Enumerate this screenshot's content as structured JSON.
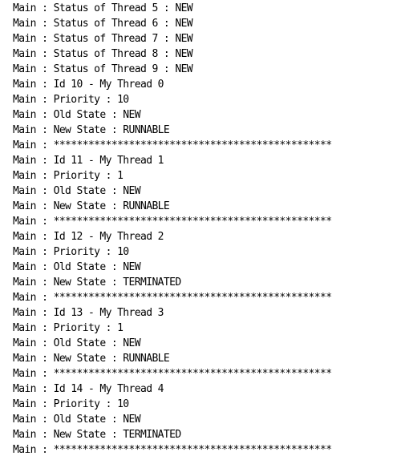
{
  "console": {
    "lines": [
      "Main : Status of Thread 5 : NEW",
      "Main : Status of Thread 6 : NEW",
      "Main : Status of Thread 7 : NEW",
      "Main : Status of Thread 8 : NEW",
      "Main : Status of Thread 9 : NEW",
      "Main : Id 10 - My Thread 0",
      "Main : Priority : 10",
      "Main : Old State : NEW",
      "Main : New State : RUNNABLE",
      "Main : ************************************************",
      "Main : Id 11 - My Thread 1",
      "Main : Priority : 1",
      "Main : Old State : NEW",
      "Main : New State : RUNNABLE",
      "Main : ************************************************",
      "Main : Id 12 - My Thread 2",
      "Main : Priority : 10",
      "Main : Old State : NEW",
      "Main : New State : TERMINATED",
      "Main : ************************************************",
      "Main : Id 13 - My Thread 3",
      "Main : Priority : 1",
      "Main : Old State : NEW",
      "Main : New State : RUNNABLE",
      "Main : ************************************************",
      "Main : Id 14 - My Thread 4",
      "Main : Priority : 10",
      "Main : Old State : NEW",
      "Main : New State : TERMINATED",
      "Main : ************************************************"
    ]
  }
}
